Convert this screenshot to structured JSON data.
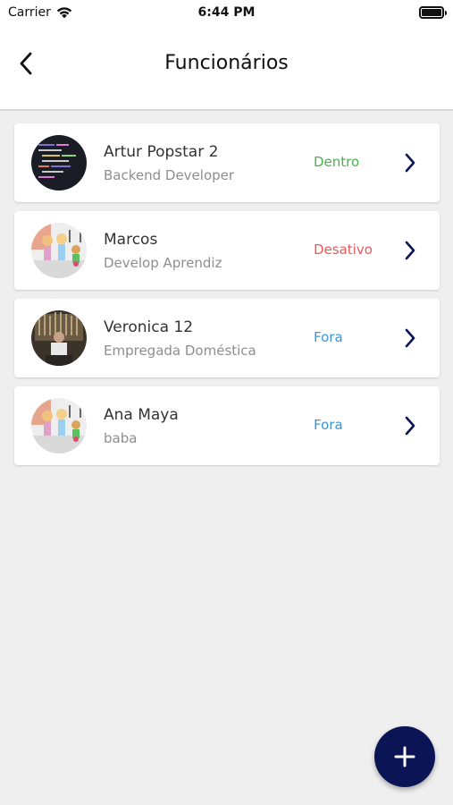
{
  "status_bar": {
    "carrier": "Carrier",
    "time": "6:44 PM"
  },
  "header": {
    "title": "Funcionários"
  },
  "employees": [
    {
      "name": "Artur Popstar 2",
      "role": "Backend Developer",
      "status": "Dentro",
      "status_color": "#4caf50"
    },
    {
      "name": "Marcos",
      "role": "Develop Aprendiz",
      "status": "Desativo",
      "status_color": "#e85a5a"
    },
    {
      "name": "Veronica 12",
      "role": "Empregada Doméstica",
      "status": "Fora",
      "status_color": "#3b96d9"
    },
    {
      "name": "Ana Maya",
      "role": "baba",
      "status": "Fora",
      "status_color": "#3b96d9"
    }
  ],
  "colors": {
    "fab": "#0b1454",
    "chevron": "#0b1454",
    "background": "#efefef"
  },
  "icons": {
    "back": "chevron-left-icon",
    "row_action": "chevron-right-icon",
    "fab": "plus-icon",
    "wifi": "wifi-icon",
    "battery": "battery-icon"
  }
}
